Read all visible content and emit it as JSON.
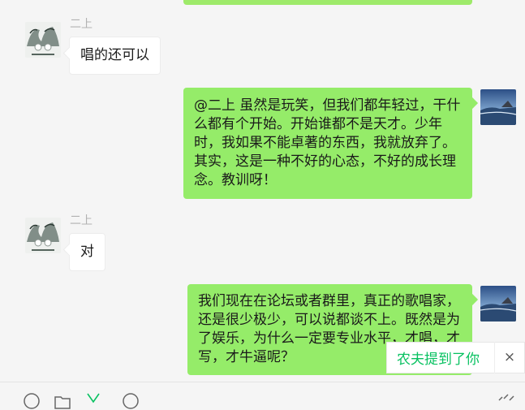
{
  "messages": [
    {
      "sender": "二上",
      "text": "唱的还可以",
      "direction": "in"
    },
    {
      "text": "@二上 虽然是玩笑，但我们都年轻过，干什么都有个开始。开始谁都不是天才。少年时，我如果不能卓著的东西，我就放弃了。其实，这是一种不好的心态，不好的成长理念。教训呀！",
      "direction": "out"
    },
    {
      "sender": "二上",
      "text": "对",
      "direction": "in"
    },
    {
      "text": "我们现在在论坛或者群里，真正的歌唱家，还是很少极少，可以说都谈不上。既然是为了娱乐，为什么一定要专业水平，才唱，才写，才牛逼呢？",
      "direction": "out"
    }
  ],
  "mention_toast": {
    "text": "农夫提到了你",
    "close_glyph": "×"
  },
  "colors": {
    "bubble_out": "#95ec69",
    "bubble_in": "#ffffff",
    "accent": "#07c160",
    "background": "#f5f5f5"
  },
  "toolbar": {
    "icons": [
      "emoji-icon",
      "folder-icon",
      "scissors-icon",
      "chat-history-icon",
      "more-icon"
    ]
  }
}
